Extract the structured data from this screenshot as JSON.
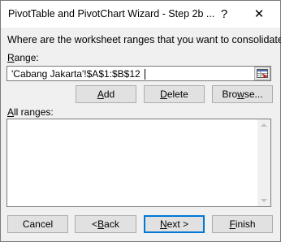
{
  "window": {
    "title": "PivotTable and PivotChart Wizard - Step 2b ...",
    "help_label": "?",
    "close_label": "✕"
  },
  "prompt": "Where are the worksheet ranges that you want to consolidate?",
  "range": {
    "label_mnemonic": "R",
    "label_rest": "ange:",
    "value": "'Cabang Jakarta'!$A$1:$B$12"
  },
  "range_buttons": {
    "add_mnemonic": "A",
    "add_rest": "dd",
    "delete_mnemonic": "D",
    "delete_rest": "elete",
    "browse_pre": "Bro",
    "browse_mnemonic": "w",
    "browse_rest": "se..."
  },
  "all_ranges": {
    "label_mnemonic": "A",
    "label_rest": "ll ranges:",
    "items": []
  },
  "footer_buttons": {
    "cancel": "Cancel",
    "back_pre": "< ",
    "back_mnemonic": "B",
    "back_rest": "ack",
    "next_mnemonic": "N",
    "next_rest": "ext >",
    "finish_mnemonic": "F",
    "finish_rest": "inish"
  }
}
